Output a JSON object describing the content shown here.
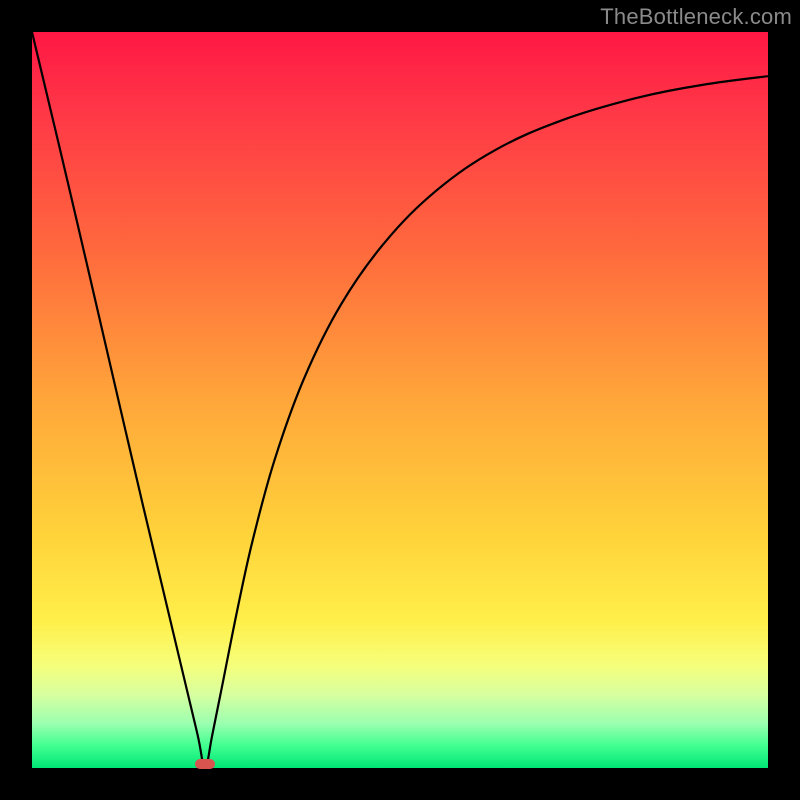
{
  "watermark": "TheBottleneck.com",
  "chart_data": {
    "type": "line",
    "title": "",
    "xlabel": "",
    "ylabel": "",
    "xlim": [
      0,
      1
    ],
    "ylim": [
      0,
      1
    ],
    "x_ticks": [],
    "y_ticks": [],
    "min_point": {
      "x": 0.235,
      "y": 0.0
    },
    "description": "Single V-shaped curve with minimum near x≈0.235; left branch nearly straight descending from top-left corner; right branch rises with decreasing slope toward upper-right.",
    "series": [
      {
        "name": "curve",
        "x": [
          0.0,
          0.05,
          0.1,
          0.15,
          0.2,
          0.225,
          0.235,
          0.245,
          0.26,
          0.28,
          0.3,
          0.33,
          0.37,
          0.42,
          0.48,
          0.55,
          0.63,
          0.72,
          0.82,
          0.91,
          1.0
        ],
        "y": [
          1.0,
          0.79,
          0.575,
          0.36,
          0.15,
          0.045,
          0.0,
          0.045,
          0.12,
          0.22,
          0.31,
          0.42,
          0.53,
          0.63,
          0.715,
          0.785,
          0.84,
          0.88,
          0.91,
          0.928,
          0.94
        ]
      }
    ],
    "background_gradient": {
      "direction": "top-to-bottom",
      "stops": [
        {
          "pos": 0.0,
          "color": "#ff1744"
        },
        {
          "pos": 0.3,
          "color": "#ff6a3d"
        },
        {
          "pos": 0.5,
          "color": "#ffa63a"
        },
        {
          "pos": 0.7,
          "color": "#ffd23a"
        },
        {
          "pos": 0.86,
          "color": "#f6ff7a"
        },
        {
          "pos": 1.0,
          "color": "#00e676"
        }
      ]
    },
    "annotation": {
      "min_marker_color": "#d8544f"
    }
  }
}
